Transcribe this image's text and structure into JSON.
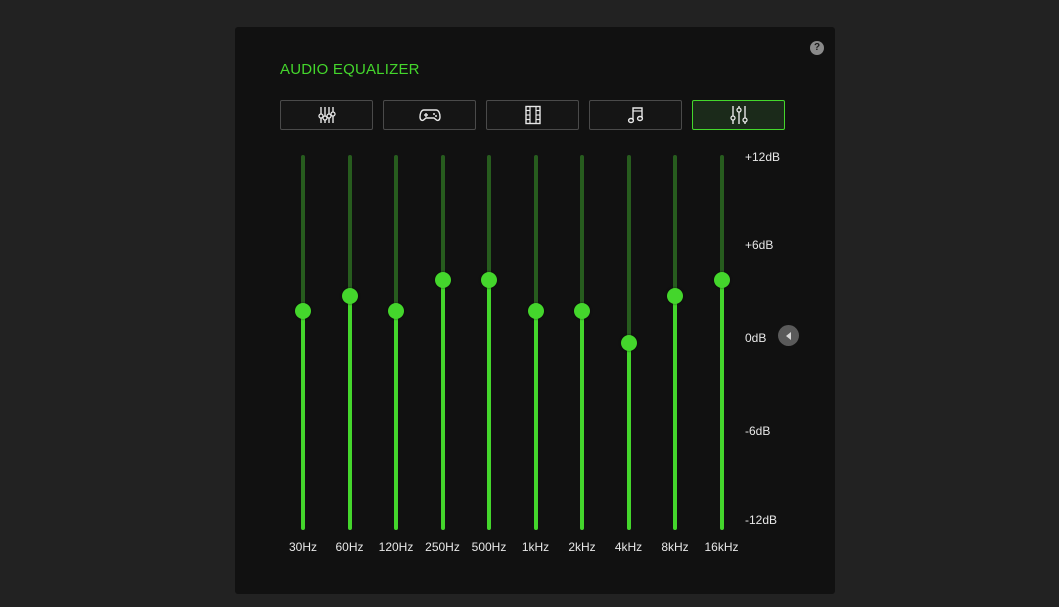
{
  "panel": {
    "title": "AUDIO EQUALIZER",
    "help_label": "?"
  },
  "presets": [
    {
      "name": "default",
      "icon": "sliders-vertical-icon",
      "active": false
    },
    {
      "name": "game",
      "icon": "gamepad-icon",
      "active": false
    },
    {
      "name": "movie",
      "icon": "film-icon",
      "active": false
    },
    {
      "name": "music",
      "icon": "music-note-icon",
      "active": false
    },
    {
      "name": "custom",
      "icon": "custom-sliders-icon",
      "active": true
    }
  ],
  "bands": [
    {
      "label": "30Hz",
      "gain_db": 2
    },
    {
      "label": "60Hz",
      "gain_db": 3
    },
    {
      "label": "120Hz",
      "gain_db": 2
    },
    {
      "label": "250Hz",
      "gain_db": 4
    },
    {
      "label": "500Hz",
      "gain_db": 4
    },
    {
      "label": "1kHz",
      "gain_db": 2
    },
    {
      "label": "2kHz",
      "gain_db": 2
    },
    {
      "label": "4kHz",
      "gain_db": 0
    },
    {
      "label": "8kHz",
      "gain_db": 3
    },
    {
      "label": "16kHz",
      "gain_db": 4
    }
  ],
  "scale": {
    "max_db": 12,
    "min_db": -12,
    "labels": [
      "+12dB",
      "+6dB",
      "0dB",
      "-6dB",
      "-12dB"
    ]
  },
  "colors": {
    "accent": "#44d62c",
    "track_dim": "#275c1e",
    "panel_bg": "#111111",
    "page_bg": "#222222"
  }
}
